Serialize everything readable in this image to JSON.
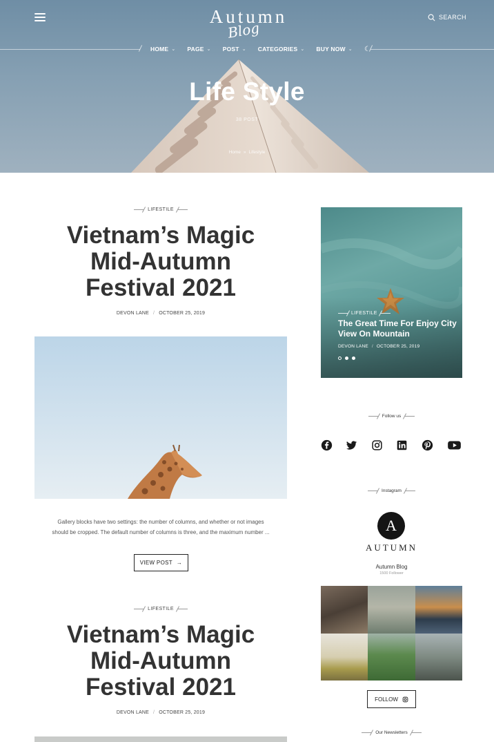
{
  "header": {
    "logo_main": "Autumn",
    "logo_script": "Blog",
    "search_label": "SEARCH",
    "nav": [
      {
        "label": "HOME"
      },
      {
        "label": "PAGE"
      },
      {
        "label": "POST"
      },
      {
        "label": "CATEGORIES"
      },
      {
        "label": "BUY NOW"
      }
    ]
  },
  "hero": {
    "title": "Life Style",
    "post_count": "38 POST",
    "breadcrumb": {
      "home": "Home",
      "separator": "»",
      "current": "Lifestyle"
    }
  },
  "posts": [
    {
      "category": "LIFESTILE",
      "title_lines": [
        "Vietnam’s Magic",
        "Mid-Autumn",
        "Festival 2021"
      ],
      "author": "DEVON LANE",
      "date": "OCTOBER 25, 2019",
      "excerpt_lines": [
        "Gallery blocks have two settings: the number of columns, and whether or not images",
        "should be cropped. The default number of columns is three, and the maximum number ..."
      ],
      "button": "VIEW POST"
    },
    {
      "category": "LIFESTILE",
      "title_lines": [
        "Vietnam’s Magic",
        "Mid-Autumn",
        "Festival 2021"
      ],
      "author": "DEVON LANE",
      "date": "OCTOBER 25, 2019"
    }
  ],
  "slider": {
    "category": "LIFESTILE",
    "title": "The Great Time For Enjoy City View On Mountain",
    "author": "DEVON LANE",
    "date": "OCTOBER 25, 2019",
    "active_dot": 2
  },
  "follow": {
    "title": "Follow us",
    "icons": [
      "facebook-icon",
      "twitter-icon",
      "instagram-icon",
      "linkedin-icon",
      "pinterest-icon",
      "youtube-icon"
    ]
  },
  "instagram": {
    "title": "Instagram",
    "avatar_letter": "A",
    "wordmark": "AUTUMN",
    "account": "Autumn Blog",
    "followers": "1500 Follower",
    "button": "FOLLOW"
  },
  "newsletter": {
    "title": "Our Newsletters"
  },
  "colors": {
    "hero_sky": "#7f9bb0",
    "dark": "#2b2b2b",
    "slider_teal": "#5d9a98"
  }
}
